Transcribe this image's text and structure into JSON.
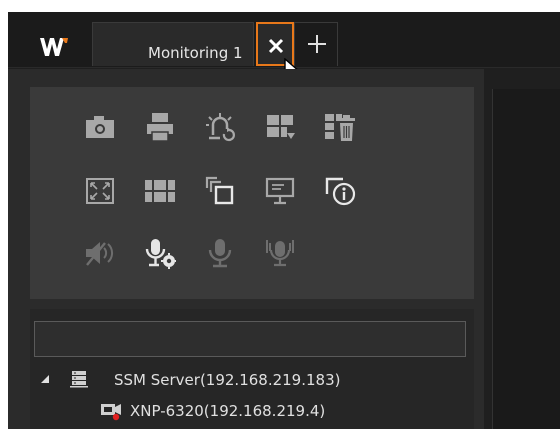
{
  "app": {
    "logo_text": "W"
  },
  "tabs": [
    {
      "label": "Monitoring 1",
      "active": true
    }
  ],
  "toolbar": {
    "rows": [
      [
        "camera-snapshot",
        "print",
        "alarm-reset",
        "layout-menu",
        "delete-layout"
      ],
      [
        "fullscreen",
        "tile-layout",
        "copy-window",
        "monitor-display",
        "info-window"
      ],
      [
        "mute-audio",
        "mic-settings",
        "microphone",
        "microphone-broadcast"
      ]
    ]
  },
  "tree": {
    "search_value": "",
    "server": {
      "label": "SSM Server(192.168.219.183)"
    },
    "devices": [
      {
        "label": "XNP-6320(192.168.219.4)"
      }
    ]
  },
  "colors": {
    "accent": "#e8781a",
    "icon": "#a8a8a8"
  }
}
